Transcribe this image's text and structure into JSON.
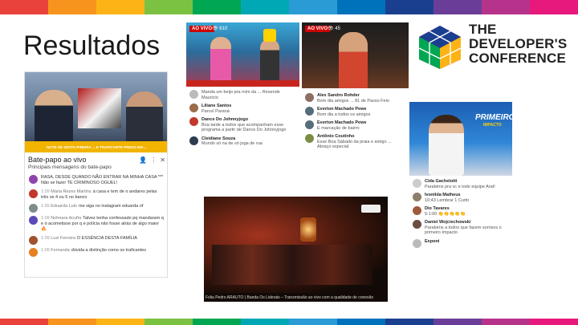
{
  "colors": {
    "top_bar": [
      "#e8423a",
      "#f7941d",
      "#fcb316",
      "#7cc242",
      "#00a651",
      "#00a8b5",
      "#2b9bd5",
      "#0072bc",
      "#1b3f8f",
      "#6a3e98",
      "#b5338a",
      "#e7197c"
    ],
    "bottom_bar": [
      "#e8423a",
      "#f7941d",
      "#fcb316",
      "#7cc242",
      "#00a651",
      "#00a8b5",
      "#2b9bd5",
      "#0072bc",
      "#1b3f8f",
      "#6a3e98",
      "#b5338a",
      "#e7197c"
    ]
  },
  "slide": {
    "title": "Resultados"
  },
  "logo": {
    "lines": [
      "THE",
      "DEVELOPER'S",
      "CONFERENCE"
    ]
  },
  "panel1": {
    "ticker_text": "NOTE DE SEXTA-PINEIRA ... E TRAFICANTE PRESO EM ...",
    "chat_title": "Bate-papo ao vivo",
    "subtitle": "Principais mensagens do bate-papo",
    "rows": [
      {
        "time": "",
        "user": "",
        "text": "RASA, DESDE QUANDO NÃO ENTRAR NA MINHA CASA *** Não se fazer TE CRIMINOSO OGUEL!"
      },
      {
        "time": "1:09",
        "user": "Maria Rezes Martins",
        "text": "à casa e tem de o andares pelas três os 4 ou 5 no banco"
      },
      {
        "time": "1:09",
        "user": "Eduarda Lulo",
        "text": "me siga no instagram eduarda of"
      },
      {
        "time": "1:09",
        "user": "Noheara Acuña",
        "text": "Talvez tenha confessado pq mandaram q e ó acometisse por q e polícia não fosse atrás de algo maior 🔥"
      },
      {
        "time": "1:09",
        "user": "Luzi Ferreira",
        "text": "D ESSÊNCIA DESTA FAMÍLIA"
      },
      {
        "time": "1:09",
        "user": "Fernanda",
        "text": "dúvida a distinção como os traficantes"
      }
    ]
  },
  "panel2": {
    "badge": "AO VIVO",
    "views": "👁 610",
    "comments": [
      {
        "name": "",
        "text": "Manda um beijo pra mim da ... Resende Mauricio"
      },
      {
        "name": "Liliane Santos",
        "text": "Parcel Paraná"
      },
      {
        "name": "Dance Do Johnnyjogo",
        "text": "Boa tarde a todos que acompanham esse programa a partir de Dance Do Johnnyjogo"
      },
      {
        "name": "Cleidiane Souza",
        "text": "Mundo só na de só joga de rua"
      }
    ]
  },
  "panel3": {
    "badge": "AO VIVO",
    "views": "👁 45",
    "comments": [
      {
        "name": "Alex Sandro Rohder",
        "text": "Bom dia amigos ... 81 de Passo Feio"
      },
      {
        "name": "Everton Machado Pewe",
        "text": "Bom dia a todos os amigos"
      },
      {
        "name": "Everton Machado Pewe",
        "text": "E marcação de bairro"
      },
      {
        "name": "Antônio Coutinho",
        "text": "Esse Boa Sábado da praia e amigo ... Abraço especial"
      }
    ]
  },
  "panel4": {
    "show_title": "PRIMEIRO",
    "show_sub": "IMPACTO",
    "comments": [
      {
        "name": "Cida Gachelotti",
        "text": "Parabéns pra vc e todo equipe Arat!"
      },
      {
        "name": "Ivonilda Matheus",
        "text": "10:43 Lembrar 1 Curtir"
      },
      {
        "name": "Dio Tavares",
        "text": "5:1:00 👏👏👏👏👏"
      },
      {
        "name": "Daniel Wojciechowski",
        "text": "Parabéns a todos que fazem sorrisos o primeiro Impacto"
      },
      {
        "name": "Exponi",
        "text": ""
      }
    ]
  },
  "panel5": {
    "caption": "Folia Pedro ARAUTO | Banda Os Liderais – Transmissão ao vivo com a qualidade de conexão"
  }
}
